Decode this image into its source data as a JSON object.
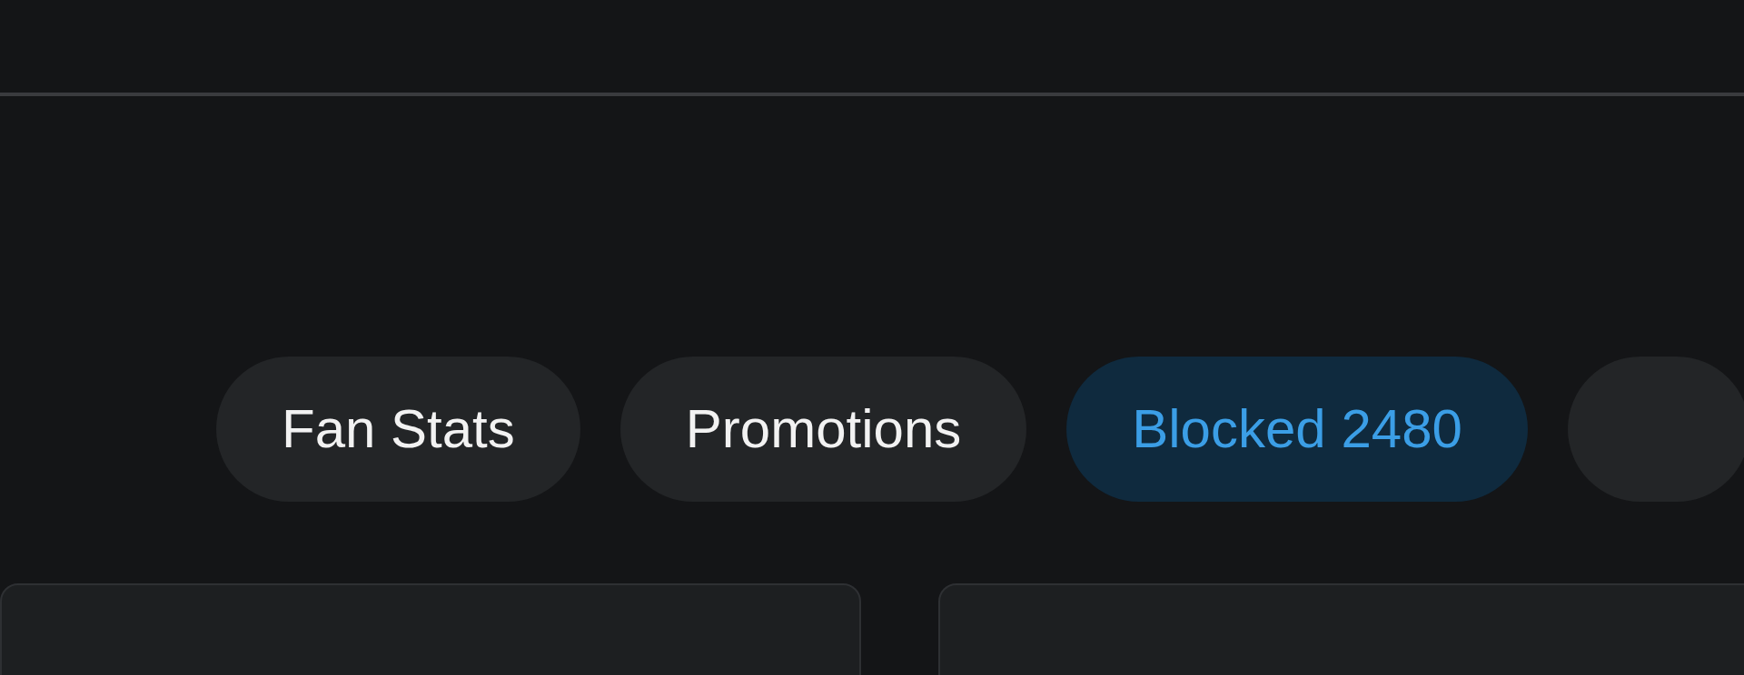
{
  "chips": [
    {
      "label": "Fan Stats",
      "selected": false
    },
    {
      "label": "Promotions",
      "selected": false
    },
    {
      "label": "Blocked 2480",
      "selected": true
    }
  ]
}
